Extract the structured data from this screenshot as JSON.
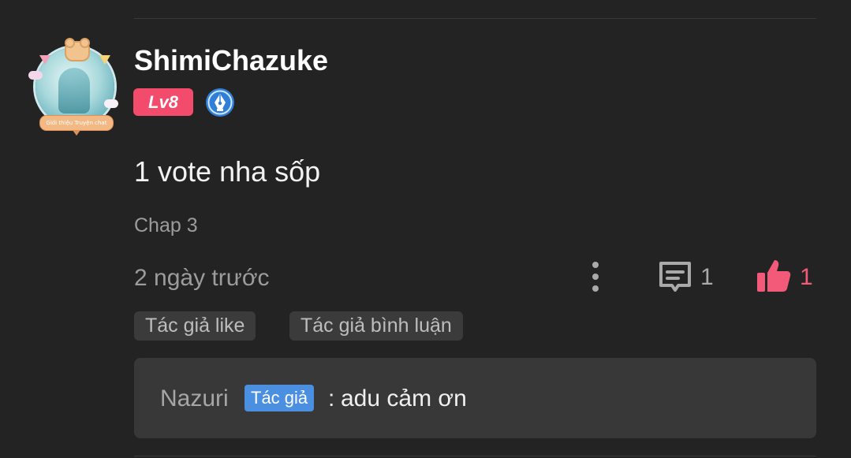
{
  "user": {
    "name": "ShimiChazuke",
    "level": "Lv8",
    "avatar_caption": "Giới thiệu Truyện chat"
  },
  "comment": {
    "text": "1 vote nha sốp",
    "chapter": "Chap 3",
    "time": "2 ngày trước",
    "reply_count": "1",
    "like_count": "1"
  },
  "tags": {
    "author_like": "Tác giả like",
    "author_comment": "Tác giả bình luận"
  },
  "reply": {
    "author": "Nazuri",
    "badge": "Tác giả",
    "separator": ":",
    "text": "adu cảm ơn"
  },
  "colors": {
    "background": "#232323",
    "level_badge": "#f34b6c",
    "like_accent": "#f35a7a",
    "author_badge": "#4a8fe0"
  },
  "icons": {
    "more": "more-vertical-icon",
    "reply": "comment-bubble-icon",
    "like": "thumbs-up-icon",
    "pen": "pen-nib-icon"
  }
}
